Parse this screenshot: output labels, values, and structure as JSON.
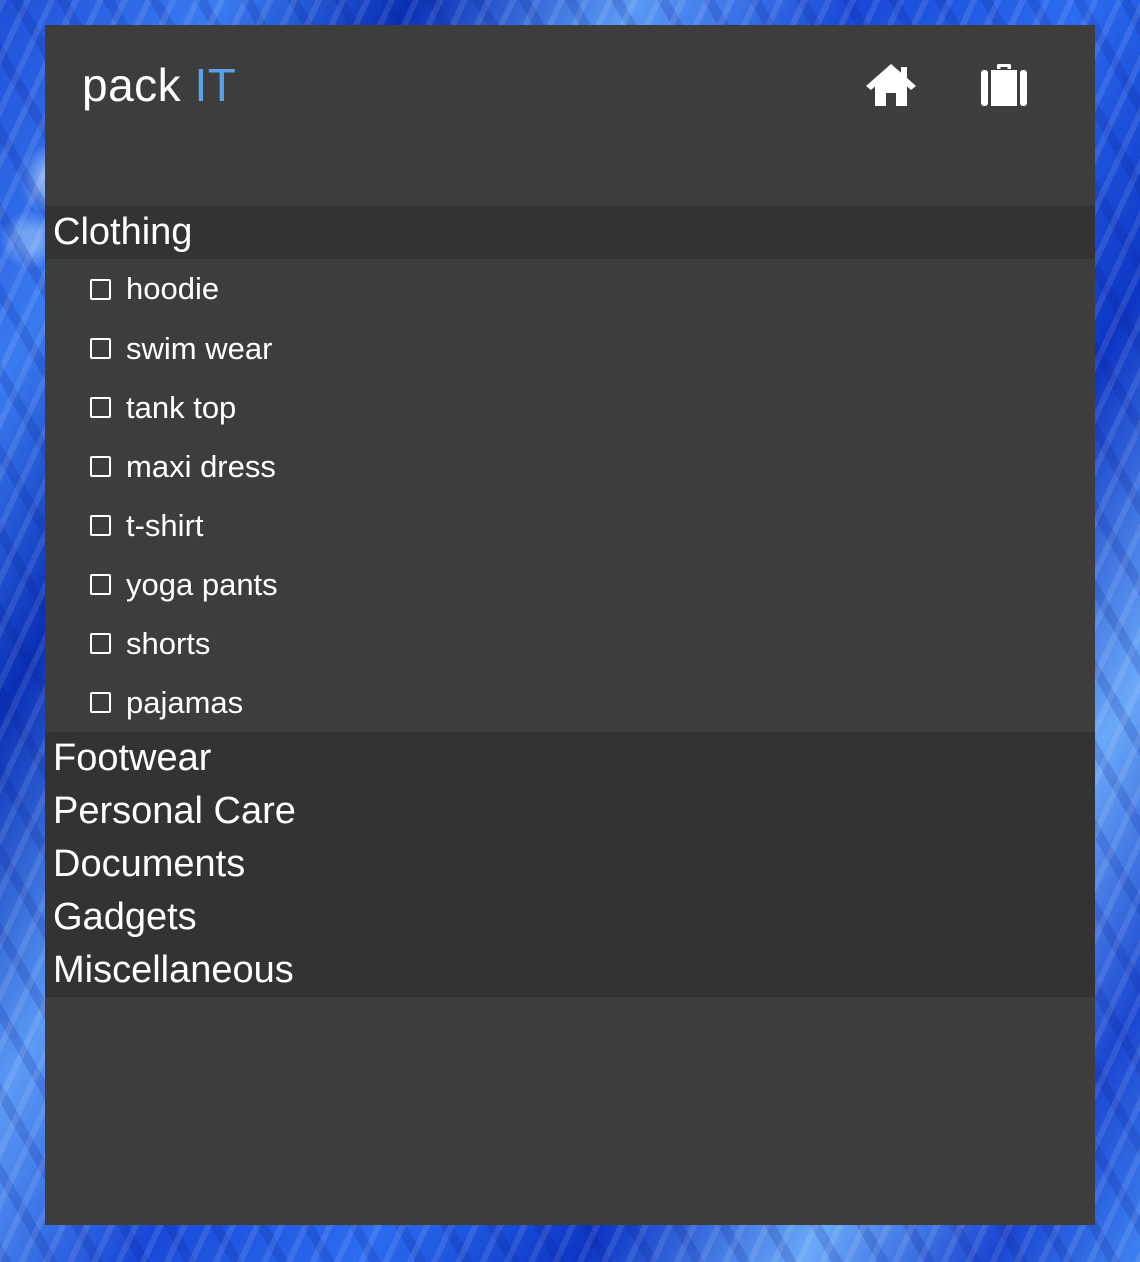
{
  "app": {
    "brand_main": "pack ",
    "brand_accent": "IT",
    "accent_color": "#5aa2e8",
    "panel_color": "#3e3d3e",
    "header_row_color": "#343334"
  },
  "toolbar": {
    "home_icon": "home-icon",
    "suitcase_icon": "suitcase-icon"
  },
  "categories": [
    {
      "name": "Clothing",
      "expanded": true,
      "items": [
        {
          "label": "hoodie",
          "checked": false
        },
        {
          "label": "swim wear",
          "checked": false
        },
        {
          "label": "tank top",
          "checked": false
        },
        {
          "label": "maxi dress",
          "checked": false
        },
        {
          "label": "t-shirt",
          "checked": false
        },
        {
          "label": "yoga pants",
          "checked": false
        },
        {
          "label": "shorts",
          "checked": false
        },
        {
          "label": "pajamas",
          "checked": false
        }
      ]
    },
    {
      "name": "Footwear",
      "expanded": false
    },
    {
      "name": "Personal Care",
      "expanded": false
    },
    {
      "name": "Documents",
      "expanded": false
    },
    {
      "name": "Gadgets",
      "expanded": false
    },
    {
      "name": "Miscellaneous",
      "expanded": false
    }
  ]
}
